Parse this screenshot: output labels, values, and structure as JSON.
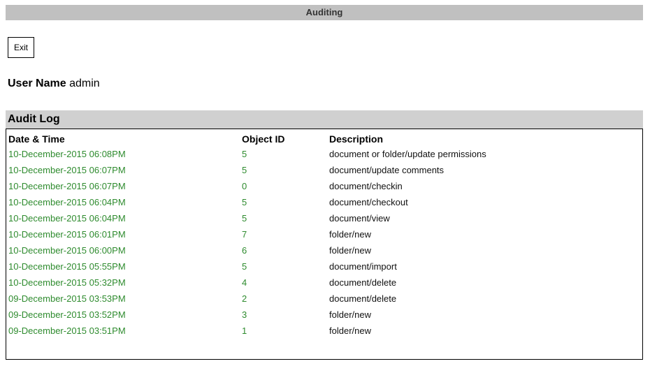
{
  "header": {
    "title": "Auditing"
  },
  "toolbar": {
    "exit_label": "Exit"
  },
  "user": {
    "label": "User Name",
    "value": "admin"
  },
  "audit_log": {
    "title": "Audit Log",
    "columns": [
      "Date & Time",
      "Object ID",
      "Description"
    ],
    "rows": [
      {
        "datetime": "10-December-2015 06:08PM",
        "object_id": "5",
        "description": "document or folder/update permissions"
      },
      {
        "datetime": "10-December-2015 06:07PM",
        "object_id": "5",
        "description": "document/update comments"
      },
      {
        "datetime": "10-December-2015 06:07PM",
        "object_id": "0",
        "description": "document/checkin"
      },
      {
        "datetime": "10-December-2015 06:04PM",
        "object_id": "5",
        "description": "document/checkout"
      },
      {
        "datetime": "10-December-2015 06:04PM",
        "object_id": "5",
        "description": "document/view"
      },
      {
        "datetime": "10-December-2015 06:01PM",
        "object_id": "7",
        "description": "folder/new"
      },
      {
        "datetime": "10-December-2015 06:00PM",
        "object_id": "6",
        "description": "folder/new"
      },
      {
        "datetime": "10-December-2015 05:55PM",
        "object_id": "5",
        "description": "document/import"
      },
      {
        "datetime": "10-December-2015 05:32PM",
        "object_id": "4",
        "description": "document/delete"
      },
      {
        "datetime": "09-December-2015 03:53PM",
        "object_id": "2",
        "description": "document/delete"
      },
      {
        "datetime": "09-December-2015 03:52PM",
        "object_id": "3",
        "description": "folder/new"
      },
      {
        "datetime": "09-December-2015 03:51PM",
        "object_id": "1",
        "description": "folder/new"
      }
    ]
  },
  "colors": {
    "title_bar_bg": "#c0c0c0",
    "section_header_bg": "#d0d0d0",
    "link_green": "#2e8b2e"
  }
}
